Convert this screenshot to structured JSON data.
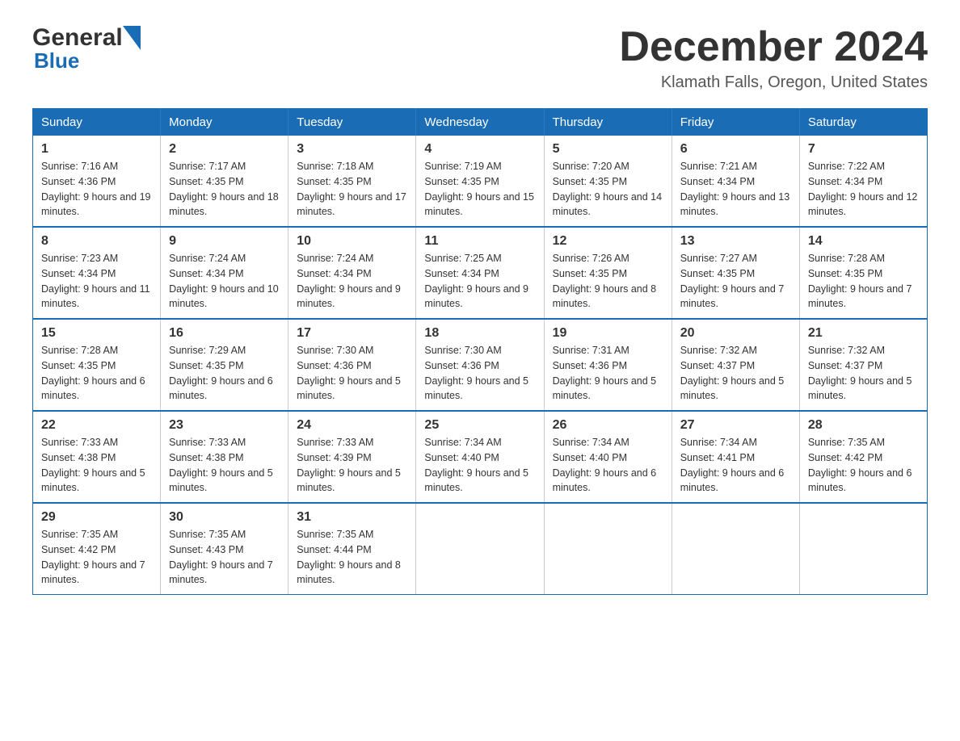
{
  "header": {
    "logo_general": "General",
    "logo_blue": "Blue",
    "title": "December 2024",
    "subtitle": "Klamath Falls, Oregon, United States"
  },
  "days_of_week": [
    "Sunday",
    "Monday",
    "Tuesday",
    "Wednesday",
    "Thursday",
    "Friday",
    "Saturday"
  ],
  "weeks": [
    [
      {
        "day": "1",
        "sunrise": "7:16 AM",
        "sunset": "4:36 PM",
        "daylight": "9 hours and 19 minutes."
      },
      {
        "day": "2",
        "sunrise": "7:17 AM",
        "sunset": "4:35 PM",
        "daylight": "9 hours and 18 minutes."
      },
      {
        "day": "3",
        "sunrise": "7:18 AM",
        "sunset": "4:35 PM",
        "daylight": "9 hours and 17 minutes."
      },
      {
        "day": "4",
        "sunrise": "7:19 AM",
        "sunset": "4:35 PM",
        "daylight": "9 hours and 15 minutes."
      },
      {
        "day": "5",
        "sunrise": "7:20 AM",
        "sunset": "4:35 PM",
        "daylight": "9 hours and 14 minutes."
      },
      {
        "day": "6",
        "sunrise": "7:21 AM",
        "sunset": "4:34 PM",
        "daylight": "9 hours and 13 minutes."
      },
      {
        "day": "7",
        "sunrise": "7:22 AM",
        "sunset": "4:34 PM",
        "daylight": "9 hours and 12 minutes."
      }
    ],
    [
      {
        "day": "8",
        "sunrise": "7:23 AM",
        "sunset": "4:34 PM",
        "daylight": "9 hours and 11 minutes."
      },
      {
        "day": "9",
        "sunrise": "7:24 AM",
        "sunset": "4:34 PM",
        "daylight": "9 hours and 10 minutes."
      },
      {
        "day": "10",
        "sunrise": "7:24 AM",
        "sunset": "4:34 PM",
        "daylight": "9 hours and 9 minutes."
      },
      {
        "day": "11",
        "sunrise": "7:25 AM",
        "sunset": "4:34 PM",
        "daylight": "9 hours and 9 minutes."
      },
      {
        "day": "12",
        "sunrise": "7:26 AM",
        "sunset": "4:35 PM",
        "daylight": "9 hours and 8 minutes."
      },
      {
        "day": "13",
        "sunrise": "7:27 AM",
        "sunset": "4:35 PM",
        "daylight": "9 hours and 7 minutes."
      },
      {
        "day": "14",
        "sunrise": "7:28 AM",
        "sunset": "4:35 PM",
        "daylight": "9 hours and 7 minutes."
      }
    ],
    [
      {
        "day": "15",
        "sunrise": "7:28 AM",
        "sunset": "4:35 PM",
        "daylight": "9 hours and 6 minutes."
      },
      {
        "day": "16",
        "sunrise": "7:29 AM",
        "sunset": "4:35 PM",
        "daylight": "9 hours and 6 minutes."
      },
      {
        "day": "17",
        "sunrise": "7:30 AM",
        "sunset": "4:36 PM",
        "daylight": "9 hours and 5 minutes."
      },
      {
        "day": "18",
        "sunrise": "7:30 AM",
        "sunset": "4:36 PM",
        "daylight": "9 hours and 5 minutes."
      },
      {
        "day": "19",
        "sunrise": "7:31 AM",
        "sunset": "4:36 PM",
        "daylight": "9 hours and 5 minutes."
      },
      {
        "day": "20",
        "sunrise": "7:32 AM",
        "sunset": "4:37 PM",
        "daylight": "9 hours and 5 minutes."
      },
      {
        "day": "21",
        "sunrise": "7:32 AM",
        "sunset": "4:37 PM",
        "daylight": "9 hours and 5 minutes."
      }
    ],
    [
      {
        "day": "22",
        "sunrise": "7:33 AM",
        "sunset": "4:38 PM",
        "daylight": "9 hours and 5 minutes."
      },
      {
        "day": "23",
        "sunrise": "7:33 AM",
        "sunset": "4:38 PM",
        "daylight": "9 hours and 5 minutes."
      },
      {
        "day": "24",
        "sunrise": "7:33 AM",
        "sunset": "4:39 PM",
        "daylight": "9 hours and 5 minutes."
      },
      {
        "day": "25",
        "sunrise": "7:34 AM",
        "sunset": "4:40 PM",
        "daylight": "9 hours and 5 minutes."
      },
      {
        "day": "26",
        "sunrise": "7:34 AM",
        "sunset": "4:40 PM",
        "daylight": "9 hours and 6 minutes."
      },
      {
        "day": "27",
        "sunrise": "7:34 AM",
        "sunset": "4:41 PM",
        "daylight": "9 hours and 6 minutes."
      },
      {
        "day": "28",
        "sunrise": "7:35 AM",
        "sunset": "4:42 PM",
        "daylight": "9 hours and 6 minutes."
      }
    ],
    [
      {
        "day": "29",
        "sunrise": "7:35 AM",
        "sunset": "4:42 PM",
        "daylight": "9 hours and 7 minutes."
      },
      {
        "day": "30",
        "sunrise": "7:35 AM",
        "sunset": "4:43 PM",
        "daylight": "9 hours and 7 minutes."
      },
      {
        "day": "31",
        "sunrise": "7:35 AM",
        "sunset": "4:44 PM",
        "daylight": "9 hours and 8 minutes."
      },
      null,
      null,
      null,
      null
    ]
  ]
}
